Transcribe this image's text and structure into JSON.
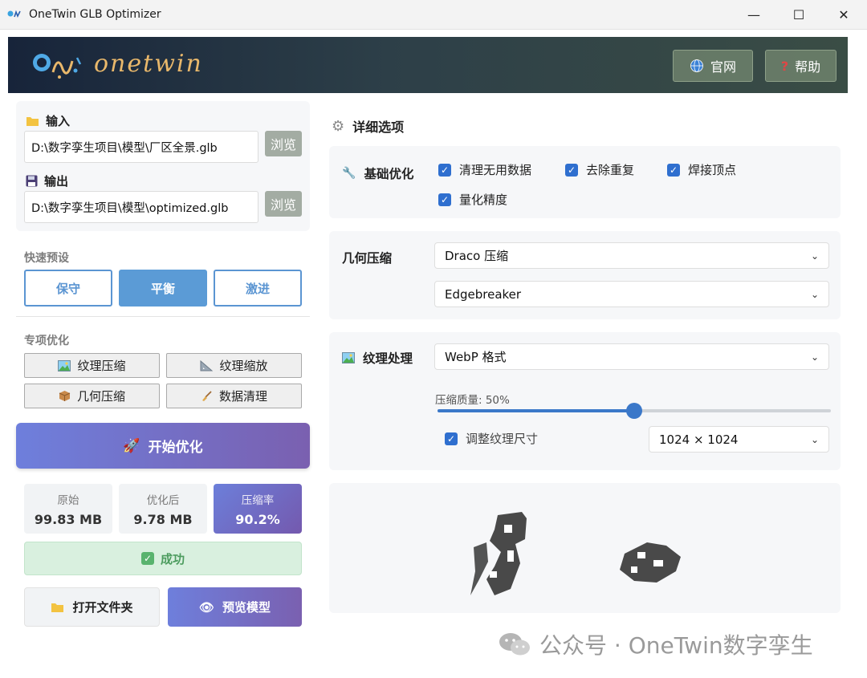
{
  "window": {
    "title": "OneTwin GLB Optimizer",
    "minimize": "—",
    "maximize": "☐",
    "close": "✕"
  },
  "header": {
    "logo_text": "onetwin",
    "site_button": "官网",
    "help_button": "帮助"
  },
  "io": {
    "input_label": "输入",
    "input_path": "D:\\数字孪生项目\\模型\\厂区全景.glb",
    "output_label": "输出",
    "output_path": "D:\\数字孪生项目\\模型\\optimized.glb",
    "browse_label": "浏览"
  },
  "presets": {
    "label": "快速预设",
    "items": [
      "保守",
      "平衡",
      "激进"
    ],
    "active": "平衡"
  },
  "special": {
    "label": "专项优化",
    "items": [
      "纹理压缩",
      "纹理缩放",
      "几何压缩",
      "数据清理"
    ]
  },
  "start_button": "开始优化",
  "stats": [
    {
      "label": "原始",
      "value": "99.83 MB"
    },
    {
      "label": "优化后",
      "value": "9.78 MB"
    },
    {
      "label": "压缩率",
      "value": "90.2%"
    }
  ],
  "status": "成功",
  "open_folder_button": "打开文件夹",
  "preview_button": "预览模型",
  "details": {
    "title": "详细选项",
    "basic": {
      "title": "基础优化",
      "options": [
        {
          "label": "清理无用数据",
          "checked": true
        },
        {
          "label": "去除重复",
          "checked": true
        },
        {
          "label": "焊接顶点",
          "checked": true
        },
        {
          "label": "量化精度",
          "checked": true
        }
      ]
    },
    "geometry": {
      "title": "几何压缩",
      "method": "Draco 压缩",
      "encoder": "Edgebreaker"
    },
    "texture": {
      "title": "纹理处理",
      "format": "WebP 格式",
      "quality_label": "压缩质量: 50%",
      "quality": 0.5,
      "resize_label": "调整纹理尺寸",
      "resize_checked": true,
      "size": "1024 × 1024"
    }
  },
  "watermark": "公众号 · OneTwin数字孪生",
  "colors": {
    "accent": "#5b9bd6",
    "primary_gradient_start": "#6e7fdc",
    "primary_gradient_end": "#7a60b0",
    "success": "#4d9c5f"
  }
}
